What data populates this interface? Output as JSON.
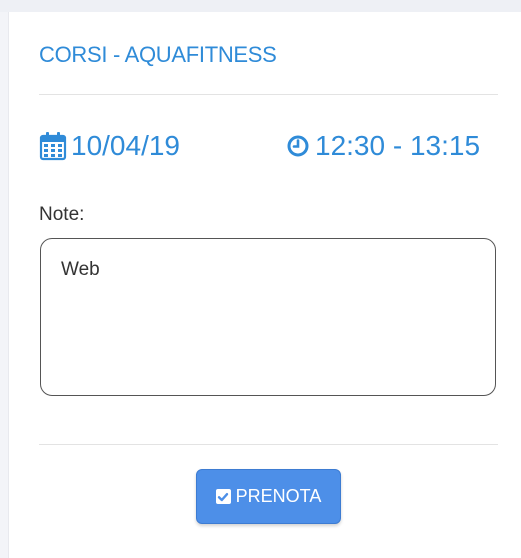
{
  "card": {
    "title": "CORSI - AQUAFITNESS",
    "date": "10/04/19",
    "time": "12:30 - 13:15",
    "note_label": "Note:",
    "note_value": "Web",
    "book_button_label": "PRENOTA"
  },
  "icons": {
    "date": "calendar-icon",
    "time": "clock-icon",
    "button": "checkbox-checked-icon"
  },
  "colors": {
    "accent": "#2f8bd8",
    "button": "#4d8fe8"
  }
}
